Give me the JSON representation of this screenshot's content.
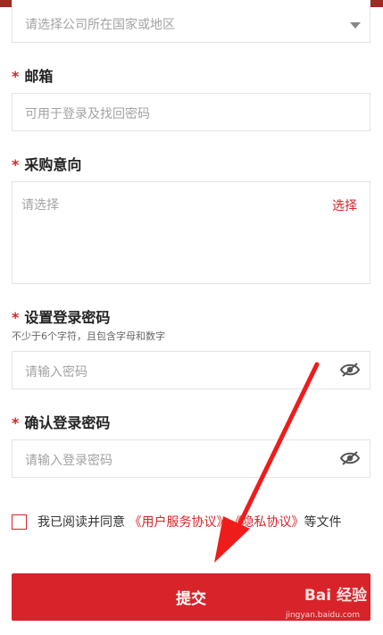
{
  "country": {
    "placeholder": "请选择公司所在国家或地区"
  },
  "email": {
    "label": "邮箱",
    "placeholder": "可用于登录及找回密码"
  },
  "intent": {
    "label": "采购意向",
    "placeholder": "请选择",
    "select_label": "选择"
  },
  "password": {
    "label": "设置登录密码",
    "hint": "不少于6个字符，且包含字母和数字",
    "placeholder": "请输入密码"
  },
  "confirm_password": {
    "label": "确认登录密码",
    "placeholder": "请输入登录密码"
  },
  "agreement": {
    "prefix": "我已阅读并同意",
    "user_agreement": "《用户服务协议》",
    "separator": "、",
    "privacy": "《隐私协议》",
    "suffix": "等文件"
  },
  "submit": {
    "label": "提交"
  },
  "watermark": {
    "text": "Bai 经验",
    "url": "jingyan.baidu.com"
  },
  "required_mark": "*",
  "colors": {
    "accent": "#d8232a",
    "top_bar": "#9e2a22"
  },
  "icons": {
    "caret": "caret-down-icon",
    "eye": "eye-off-icon",
    "arrow": "annotation-arrow"
  }
}
